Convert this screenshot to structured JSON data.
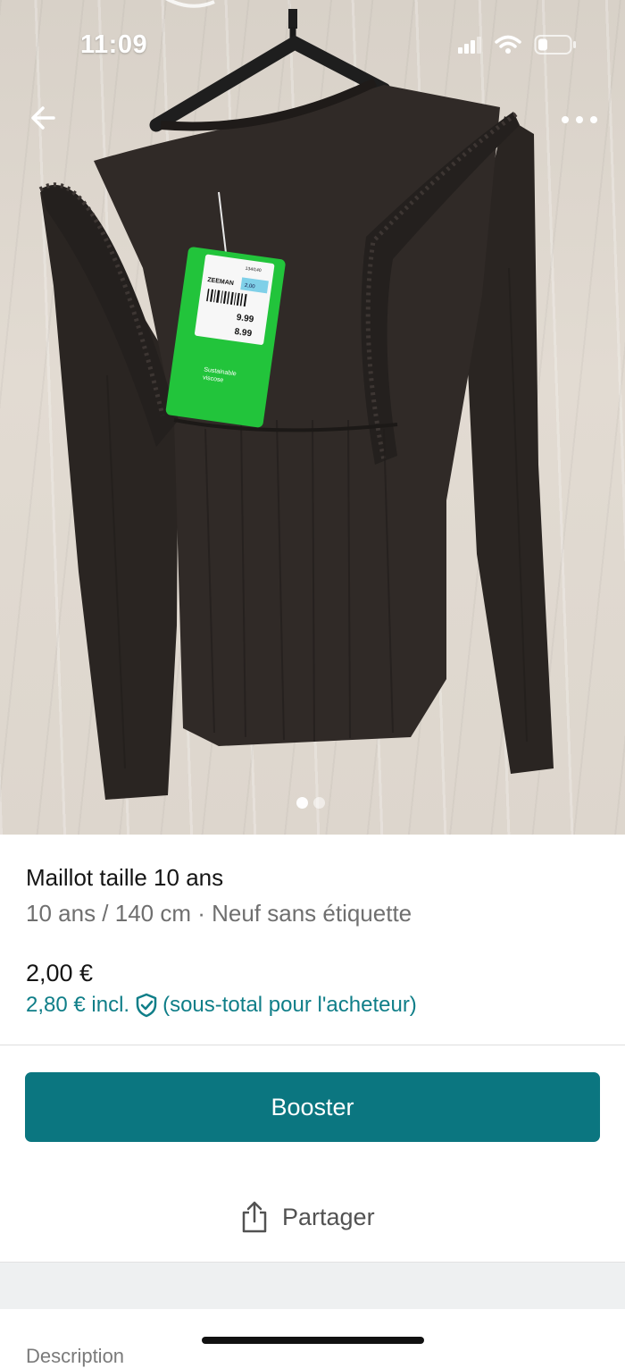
{
  "status_bar": {
    "time": "11:09"
  },
  "photo": {
    "tag_brand": "ZEEMAN",
    "tag_price_1": "9.99",
    "tag_price_2": "8.99",
    "tag_size": "134/140",
    "tag_age": "8-10 Y",
    "tag_sticker": "2,00",
    "tag_green_text_1": "Sustainable",
    "tag_green_text_2": "viscose",
    "carousel_total": 2,
    "carousel_active": 1
  },
  "nav": {
    "back_icon": "arrow-left-icon",
    "more_icon": "more-horizontal-icon"
  },
  "item": {
    "title": "Maillot taille 10 ans",
    "subtitle": "10 ans / 140 cm · Neuf sans étiquette",
    "price": "2,00 €",
    "price_incl": "2,80 € incl.",
    "price_incl_note": "(sous-total pour l'acheteur)"
  },
  "actions": {
    "booster_label": "Booster",
    "share_label": "Partager"
  },
  "description": {
    "label": "Description"
  },
  "colors": {
    "accent": "#0b7680",
    "link": "#0f7e88"
  }
}
